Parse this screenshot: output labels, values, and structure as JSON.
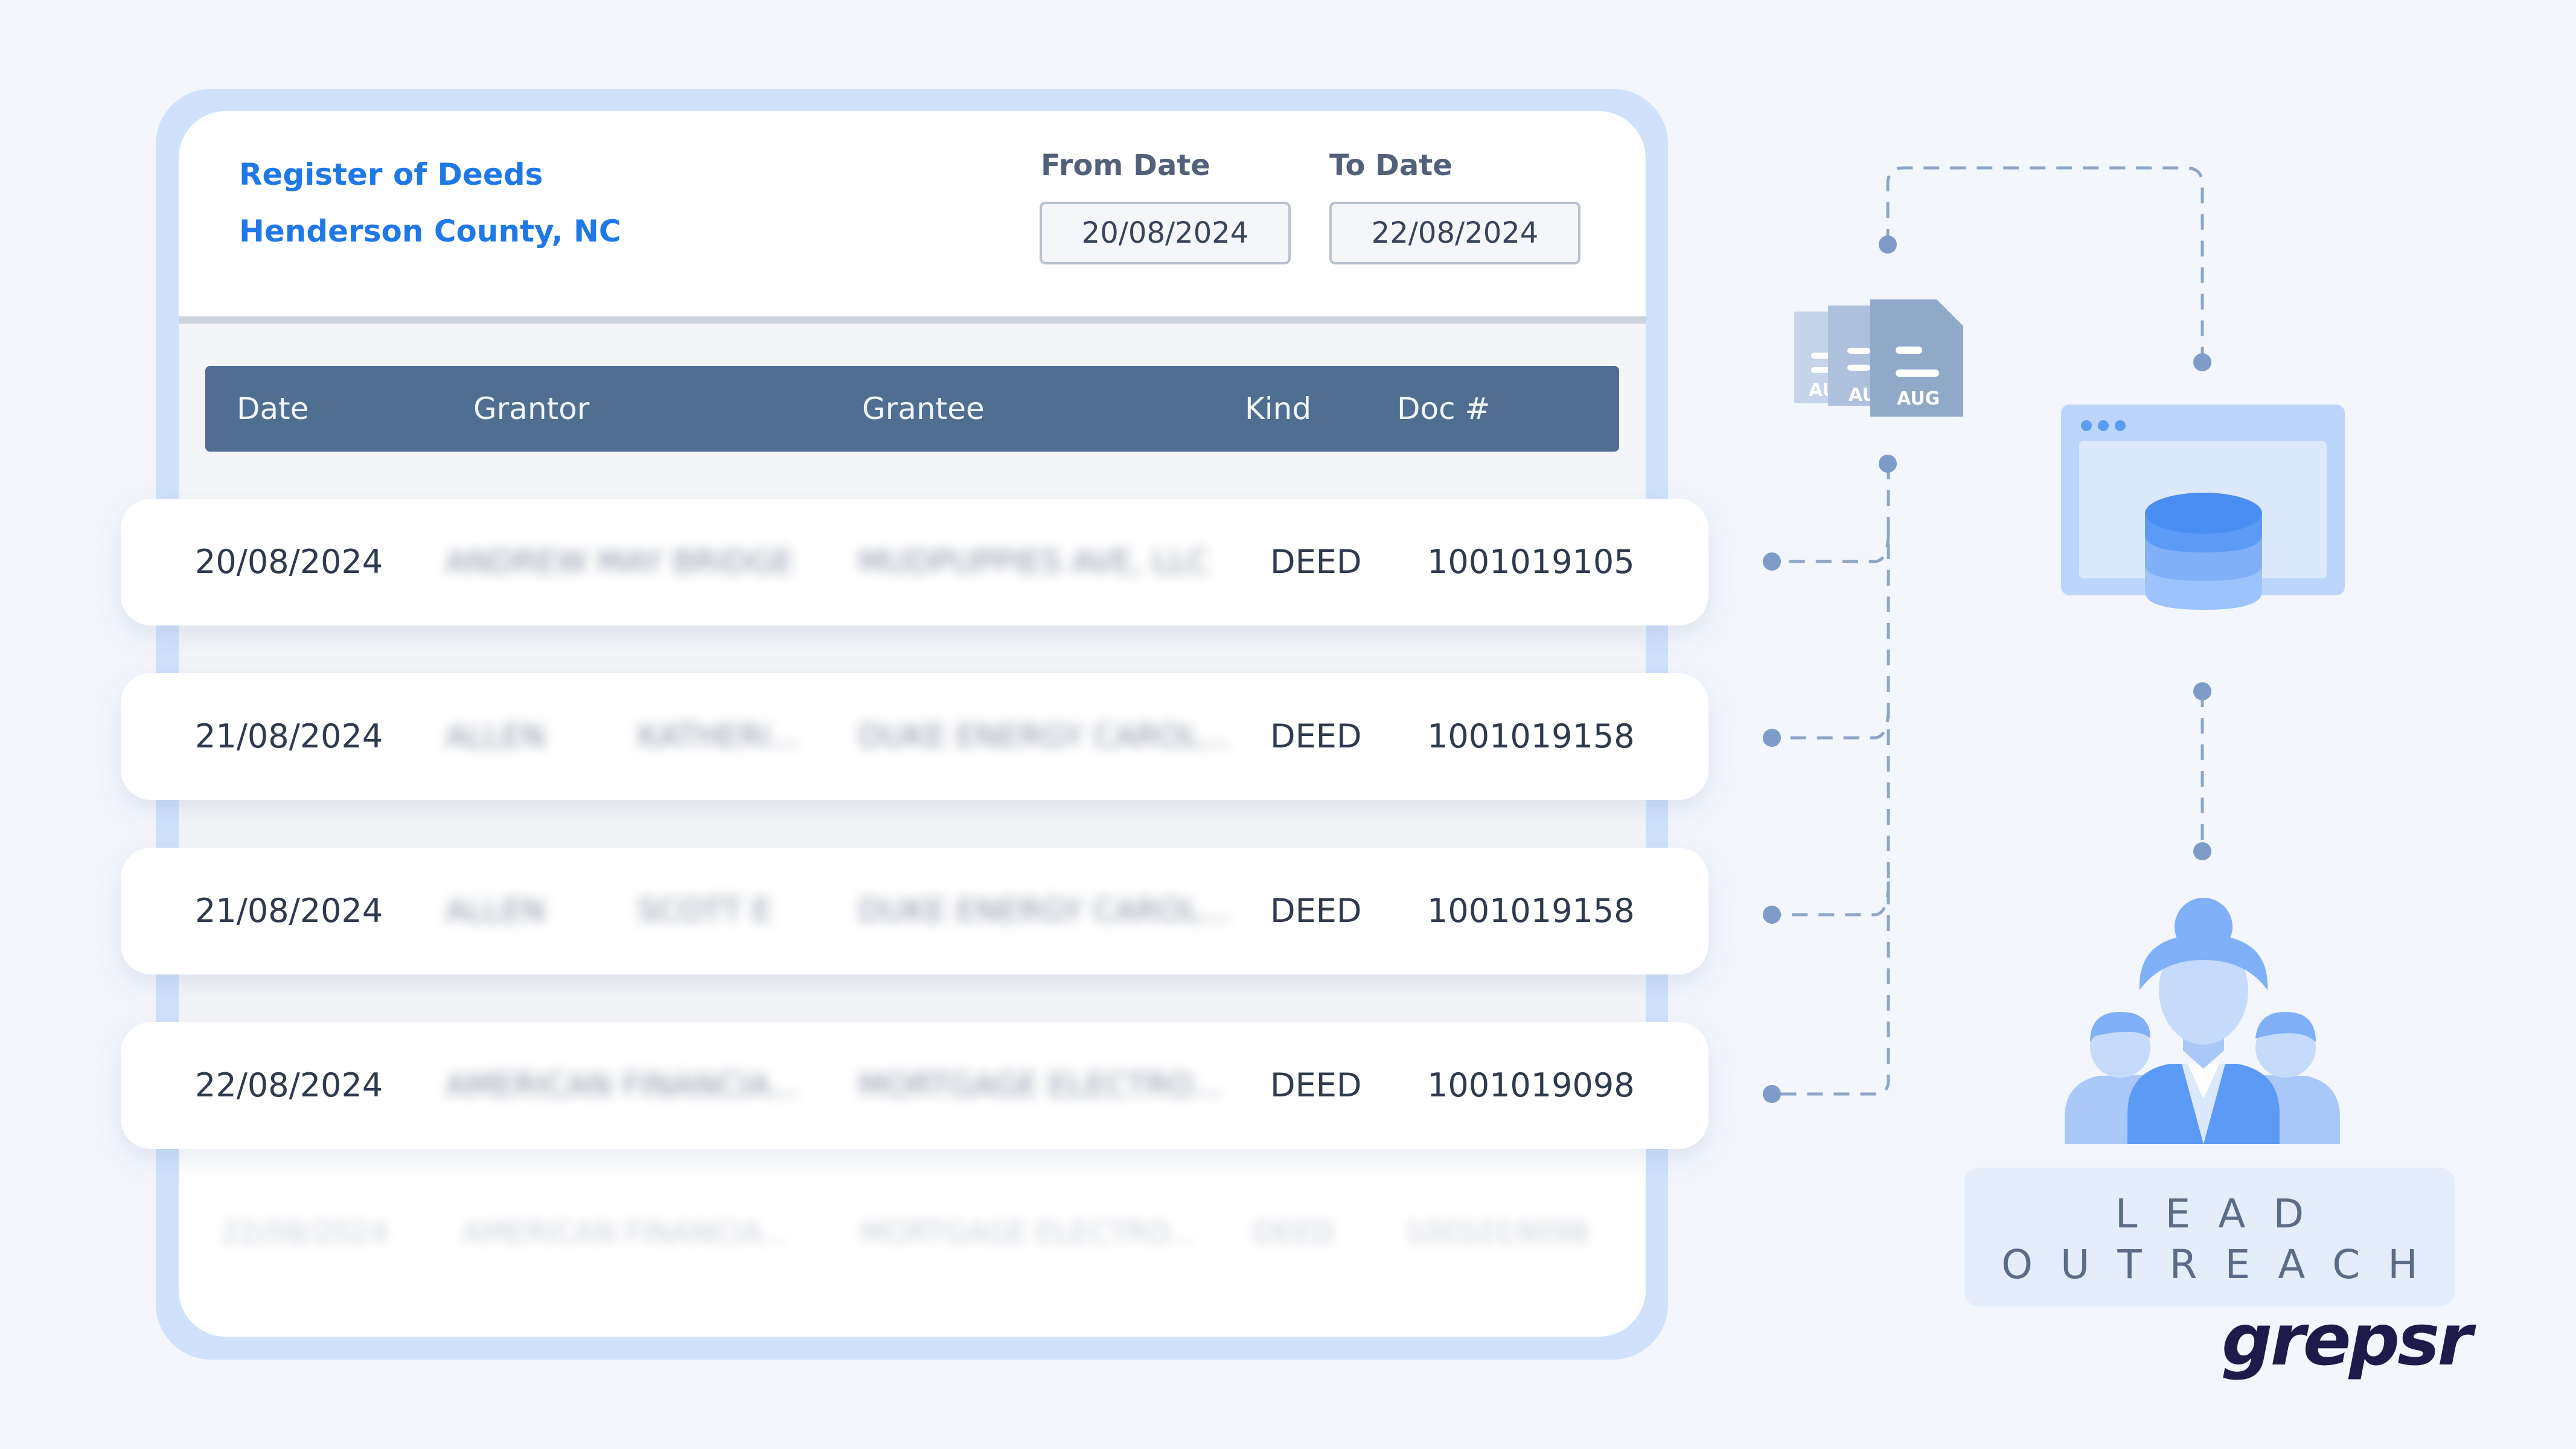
{
  "header": {
    "site_name": "Register of Deeds",
    "county": "Henderson County, NC",
    "from_label": "From Date",
    "from_value": "20/08/2024",
    "to_label": "To Date",
    "to_value": "22/08/2024"
  },
  "table": {
    "columns": [
      "Date",
      "Grantor",
      "Grantee",
      "Kind",
      "Doc #"
    ],
    "rows": [
      {
        "date": "20/08/2024",
        "grantor_1": "ANDREW MAY BRIDGE",
        "grantor_2": "",
        "grantee": "MUDPUPPIES AVE, LLC",
        "kind": "DEED",
        "doc": "1001019105"
      },
      {
        "date": "21/08/2024",
        "grantor_1": "ALLEN",
        "grantor_2": "KATHERI...",
        "grantee": "DUKE ENERGY CAROL...",
        "kind": "DEED",
        "doc": "1001019158"
      },
      {
        "date": "21/08/2024",
        "grantor_1": "ALLEN",
        "grantor_2": "SCOTT E",
        "grantee": "DUKE ENERGY CAROL...",
        "kind": "DEED",
        "doc": "1001019158"
      },
      {
        "date": "22/08/2024",
        "grantor_1": "AMERICAN FINANCIA...",
        "grantor_2": "",
        "grantee": "MORTGAGE ELECTRO...",
        "kind": "DEED",
        "doc": "1001019098"
      }
    ],
    "ghost_row": {
      "date": "22/08/2024",
      "grantor": "AMERICAN FINANCIA...",
      "grantee": "MORTGAGE ELECTRO...",
      "kind": "DEED",
      "doc": "1001019098"
    }
  },
  "flow": {
    "doc_stack_label": "AUG",
    "doc_stack_label_partial": "AU",
    "icons": [
      "document-stack-icon",
      "database-browser-icon",
      "team-icon"
    ],
    "colors": {
      "accent": "#1f78e6",
      "connector": "#8ea5c8",
      "icon_blue": "#5b9bf5"
    }
  },
  "lead": {
    "line1": "LEAD",
    "line2": "OUTREACH"
  },
  "brand": {
    "name": "grepsr"
  }
}
